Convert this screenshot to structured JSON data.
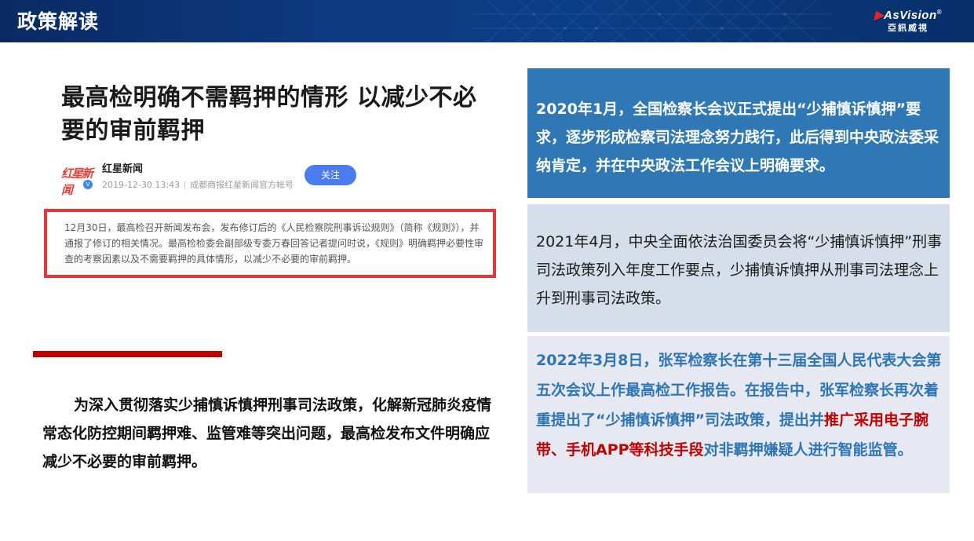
{
  "header": {
    "title": "政策解读",
    "brand_en": "AsVision",
    "brand_en_mark": "®",
    "brand_cn": "亞訊威視"
  },
  "article": {
    "title": "最高检明确不需羁押的情形 以减少不必要的审前羁押",
    "logo_text": "红星新闻",
    "logo_badge": "v",
    "source_name": "红星新闻",
    "date": "2019-12-30 13:43",
    "source_desc": "成都商报红星新闻官方帐号",
    "follow_label": "关注",
    "excerpt": "12月30日，最高检召开新闻发布会，发布修订后的《人民检察院刑事诉讼规则》（简称《规则》），并通报了修订的相关情况。最高检检委会副部级专委万春回答记者提问时说，《规则》明确羁押必要性审查的考察因素以及不需要羁押的具体情形，以减少不必要的审前羁押。"
  },
  "summary": {
    "text": "为深入贯彻落实少捕慎诉慎押刑事司法政策，化解新冠肺炎疫情常态化防控期间羁押难、监管难等突出问题，最高检发布文件明确应减少不必要的审前羁押。"
  },
  "timeline": [
    {
      "text": "2020年1月，全国检察长会议正式提出“少捕慎诉慎押”要求，逐步形成检察司法理念努力践行，此后得到中央政法委采纳肯定，并在中央政法工作会议上明确要求。"
    },
    {
      "text": "2021年4月，中央全面依法治国委员会将“少捕慎诉慎押”刑事司法政策列入年度工作要点，少捕慎诉慎押从刑事司法理念上升到刑事司法政策。"
    },
    {
      "text_before": "2022年3月8日，张军检察长在第十三届全国人民代表大会第五次会议上作最高检工作报告。在报告中，张军检察长再次着重提出了“少捕慎诉慎押”司法政策，提出并",
      "text_highlight": "推广采用电子腕带、手机APP等科技手段",
      "text_after": "对非羁押嫌疑人进行智能监管。"
    }
  ],
  "colors": {
    "header_bg": "#0d3a82",
    "panel_blue": "#2f78b5",
    "panel_gray": "#d5dee9",
    "panel_light": "#e6e9f1",
    "accent_red": "#c00000",
    "highlight_border": "#e8373a",
    "follow_button": "#4a7cf0"
  }
}
